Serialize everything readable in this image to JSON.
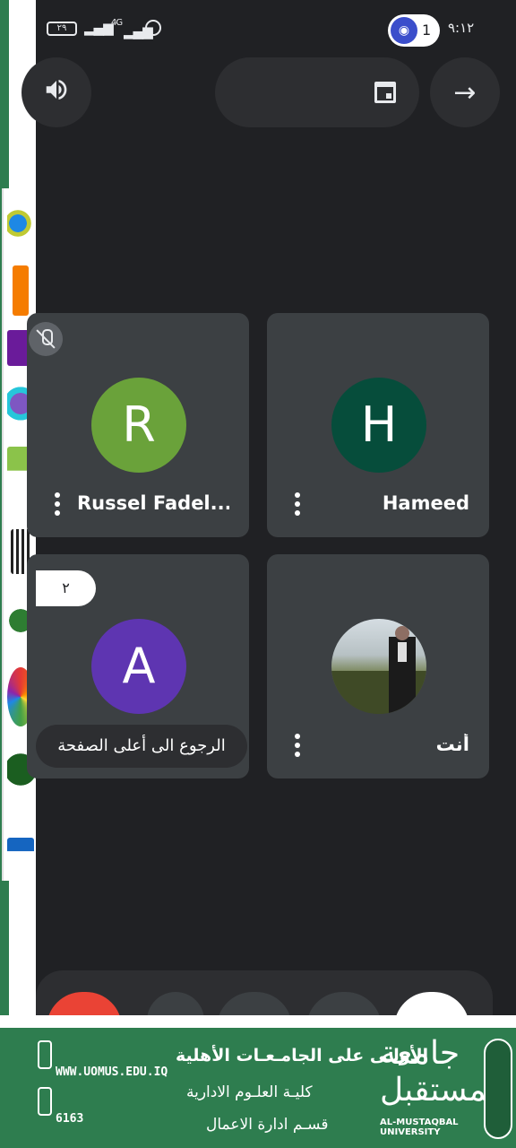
{
  "status_bar": {
    "battery": "٢٩",
    "network": "4G",
    "participant_count": "1",
    "time": "٩:١٢"
  },
  "icons": {
    "speaker": "volume-up-icon",
    "calendar": "calendar-icon",
    "next": "arrow-right-icon",
    "mic_off": "mic-off-icon",
    "more": "more-vert-icon",
    "wifi": "wifi-icon",
    "alarm": "alarm-icon"
  },
  "top_controls": {
    "next_glyph": "→",
    "speaker_glyph": "🔊"
  },
  "participants": [
    {
      "name": "Russel Fadel...",
      "initial": "R",
      "color": "#6aa23a",
      "muted": true
    },
    {
      "name": "Hameed",
      "initial": "H",
      "color": "#064d3b",
      "muted": false
    },
    {
      "name": "",
      "initial": "A",
      "color": "#5e35b1",
      "muted": false
    },
    {
      "name": "أنت",
      "initial": "",
      "color": "",
      "muted": false
    }
  ],
  "page_pill": "٢",
  "back_to_top": "الرجوع الى أعلى الصفحة",
  "footer": {
    "url": "WWW.UOMUS.EDU.IQ",
    "phone": "6163",
    "line1": "الأولـى على الجامـعـات الأهلية",
    "line2": "كليـة العلـوم الادارية",
    "line3": "قسـم ادارة الاعمال",
    "university_ar": "جامعة المستقبل",
    "university_en": "AL-MUSTAQBAL UNIVERSITY"
  },
  "colors": {
    "background": "#202124",
    "tile": "#3c4043",
    "footer_green": "#2e7d4f",
    "hangup_red": "#ea4335"
  }
}
